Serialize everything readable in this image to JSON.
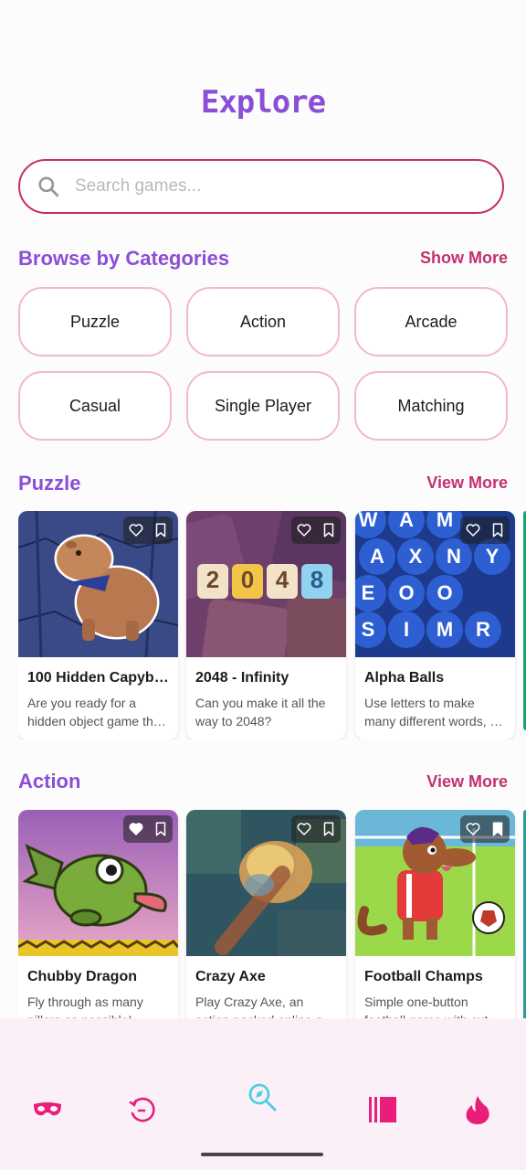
{
  "header": {
    "title": "Explore"
  },
  "search": {
    "placeholder": "Search games..."
  },
  "categories": {
    "title": "Browse by Categories",
    "link": "Show More",
    "items": [
      "Puzzle",
      "Action",
      "Arcade",
      "Casual",
      "Single Player",
      "Matching"
    ]
  },
  "sections": [
    {
      "title": "Puzzle",
      "link": "View More",
      "games": [
        {
          "name": "100 Hidden Capyb…",
          "desc": "Are you ready for a hidden object game th…"
        },
        {
          "name": "2048 - Infinity",
          "desc": "Can you make it all the way to 2048?",
          "tiles": [
            "2",
            "0",
            "4",
            "8"
          ]
        },
        {
          "name": "Alpha Balls",
          "desc": "Use letters to make many different words, …",
          "letters": [
            "W",
            "A",
            "M",
            "A",
            "X",
            "N",
            "Y",
            "E",
            "O",
            "O",
            "S",
            "I",
            "M",
            "R"
          ]
        }
      ]
    },
    {
      "title": "Action",
      "link": "View More",
      "games": [
        {
          "name": "Chubby Dragon",
          "desc": "Fly through as many pillars as possible!"
        },
        {
          "name": "Crazy Axe",
          "desc": "Play Crazy Axe, an action packed online g…"
        },
        {
          "name": "Football Champs",
          "desc": "Simple one-button football game with cut…"
        }
      ]
    }
  ],
  "colors": {
    "accent": "#8a4fd6",
    "link": "#c2316e",
    "nav_pink": "#e91e7a",
    "nav_cyan": "#4dd0e1"
  },
  "nav": [
    "mask-icon",
    "history-icon",
    "explore-icon",
    "library-icon",
    "flame-icon"
  ]
}
